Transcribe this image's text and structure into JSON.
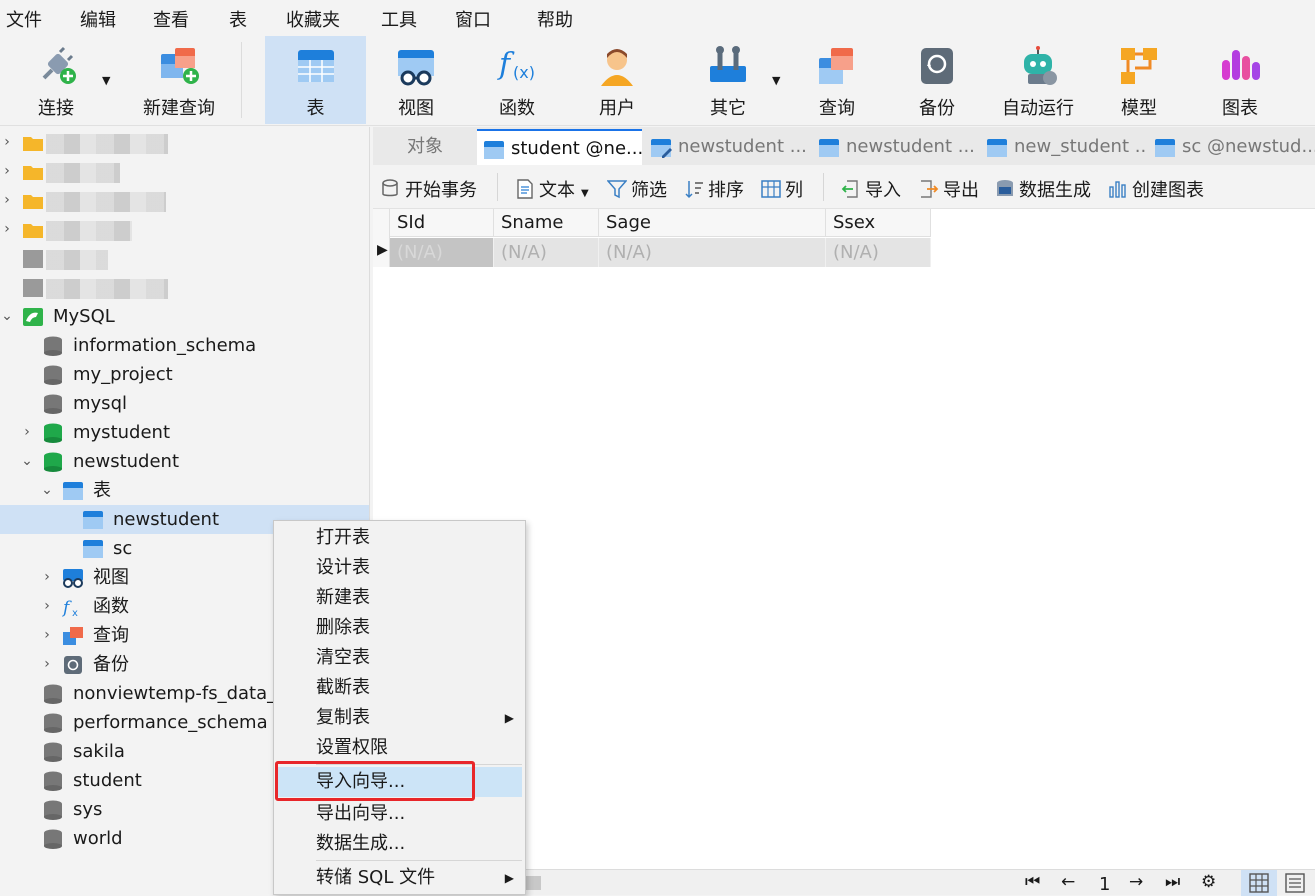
{
  "menubar": [
    "文件",
    "编辑",
    "查看",
    "表",
    "收藏夹",
    "工具",
    "窗口",
    "帮助"
  ],
  "toolbar": {
    "items": [
      {
        "label": "连接",
        "icon": "plug-icon"
      },
      {
        "label": "新建查询",
        "icon": "new-query-icon"
      },
      {
        "label": "表",
        "icon": "table-icon",
        "active": true
      },
      {
        "label": "视图",
        "icon": "view-icon"
      },
      {
        "label": "函数",
        "icon": "function-icon"
      },
      {
        "label": "用户",
        "icon": "user-icon"
      },
      {
        "label": "其它",
        "icon": "tools-icon"
      },
      {
        "label": "查询",
        "icon": "query-icon"
      },
      {
        "label": "备份",
        "icon": "backup-icon"
      },
      {
        "label": "自动运行",
        "icon": "robot-icon"
      },
      {
        "label": "模型",
        "icon": "model-icon"
      },
      {
        "label": "图表",
        "icon": "chart-icon"
      }
    ]
  },
  "sidebar": {
    "connection": "MySQL",
    "databases_top": [
      "information_schema",
      "my_project",
      "mysql",
      "mystudent"
    ],
    "open_db": "newstudent",
    "tables_group": "表",
    "tables": [
      "newstudent",
      "sc"
    ],
    "groups": [
      "视图",
      "函数",
      "查询",
      "备份"
    ],
    "databases_bottom": [
      "nonviewtemp-fs_data_r",
      "performance_schema",
      "sakila",
      "student",
      "sys",
      "world"
    ]
  },
  "tabs": [
    "对象",
    "student @ne...",
    "newstudent ...",
    "newstudent ...",
    "new_student ...",
    "sc @newstud..."
  ],
  "subbar": [
    "开始事务",
    "文本",
    "筛选",
    "排序",
    "列",
    "导入",
    "导出",
    "数据生成",
    "创建图表"
  ],
  "grid": {
    "columns": [
      "SId",
      "Sname",
      "Sage",
      "Ssex"
    ],
    "row": [
      "(N/A)",
      "(N/A)",
      "(N/A)",
      "(N/A)"
    ]
  },
  "status": {
    "page": "1"
  },
  "context_menu": {
    "items": [
      "打开表",
      "设计表",
      "新建表",
      "删除表",
      "清空表",
      "截断表",
      "复制表",
      "设置权限",
      "导入向导...",
      "导出向导...",
      "数据生成...",
      "转储 SQL 文件"
    ],
    "highlighted": "导入向导..."
  },
  "colors": {
    "accent": "#1a73e8",
    "selection": "#cfe1f5",
    "highlight_box": "#e8262a"
  }
}
